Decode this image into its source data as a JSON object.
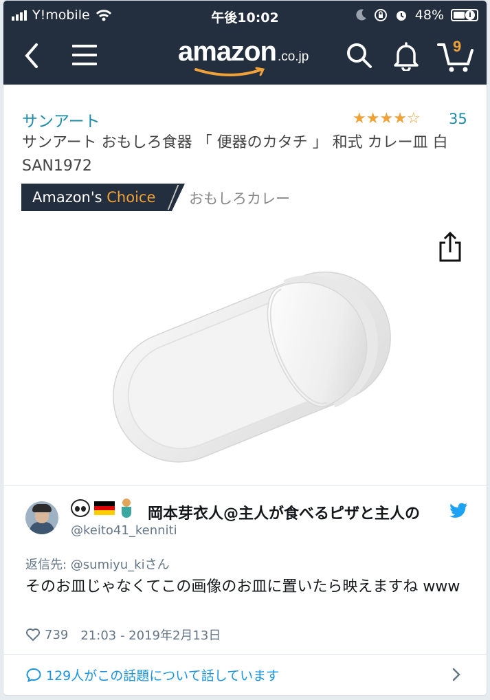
{
  "status_bar": {
    "carrier": "Y!mobile",
    "time": "午後10:02",
    "battery_percent": "48%"
  },
  "amazon": {
    "logo_word": "amazon",
    "logo_tld": ".co.jp",
    "cart_count": "9",
    "brand": "サンアート",
    "rating_stars": 4,
    "rating_count": "35",
    "product_title": "サンアート おもしろ食器 「 便器のカタチ 」 和式 カレー皿 白 SAN1972",
    "choice_badge_prefix": "Amazon's ",
    "choice_badge_accent": "Choice",
    "choice_category": "おもしろカレー",
    "colors": {
      "navy": "#232f3e",
      "orange": "#f0a238",
      "link": "#1d8ba6"
    }
  },
  "tweet": {
    "display_name": "岡本芽衣人@主人が食べるピザと主人の",
    "handle": "@keito41_kenniti",
    "reply_to": "返信先: @sumiyu_kiさん",
    "text": "そのお皿じゃなくてこの画像のお皿に置いたら映えますね www",
    "likes": "739",
    "timestamp": "21:03 - 2019年2月13日",
    "emoji_icons": [
      "panda-emoji",
      "germany-flag-emoji",
      "mermaid-emoji"
    ],
    "footer_text": "129人がこの話題について話しています",
    "colors": {
      "link": "#1b95e0",
      "secondary": "#657786",
      "twitter_blue": "#1da1f2"
    }
  }
}
